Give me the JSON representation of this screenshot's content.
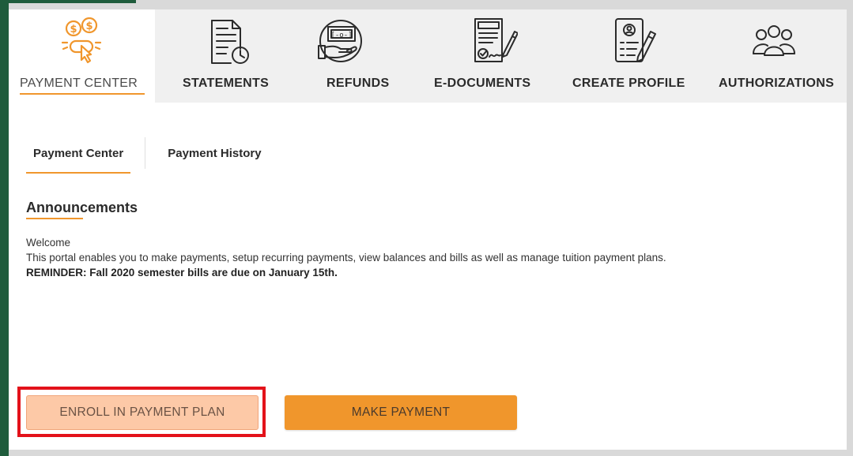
{
  "topnav": {
    "items": [
      {
        "label": "PAYMENT CENTER",
        "icon": "payment-cursor-icon",
        "active": true
      },
      {
        "label": "STATEMENTS",
        "icon": "statement-clock-icon",
        "active": false
      },
      {
        "label": "REFUNDS",
        "icon": "money-hand-icon",
        "active": false
      },
      {
        "label": "E-DOCUMENTS",
        "icon": "signed-document-icon",
        "active": false
      },
      {
        "label": "CREATE PROFILE",
        "icon": "profile-edit-icon",
        "active": false
      },
      {
        "label": "AUTHORIZATIONS",
        "icon": "group-users-icon",
        "active": false
      }
    ]
  },
  "subtabs": {
    "payment_center": "Payment Center",
    "payment_history": "Payment History"
  },
  "announcements": {
    "title": "Announcements",
    "welcome": "Welcome",
    "body": "This portal enables you to make payments, setup recurring payments, view balances and bills as well as manage tuition payment plans.",
    "reminder": "REMINDER: Fall 2020 semester bills are due on January 15th."
  },
  "actions": {
    "enroll_label": "ENROLL IN PAYMENT PLAN",
    "make_payment_label": "MAKE PAYMENT"
  },
  "colors": {
    "accent": "#f0962c",
    "frame_green": "#1f5c3c",
    "highlight_red": "#e3121a"
  }
}
